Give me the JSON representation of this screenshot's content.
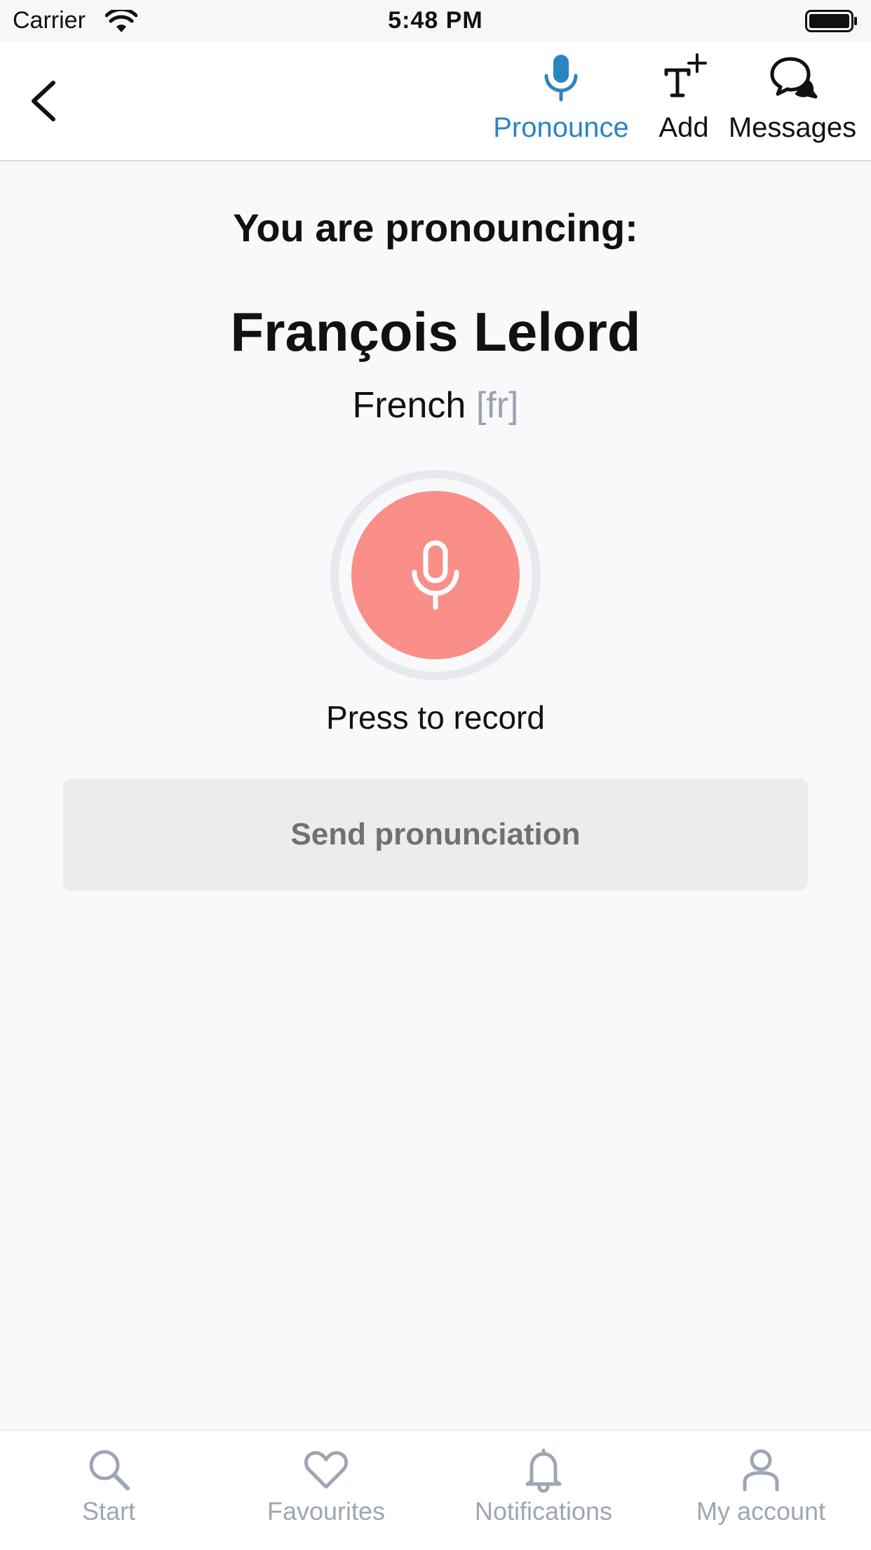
{
  "status_bar": {
    "carrier": "Carrier",
    "time": "5:48 PM"
  },
  "nav": {
    "tabs": [
      {
        "label": "Pronounce",
        "icon": "microphone-icon",
        "active": true
      },
      {
        "label": "Add",
        "icon": "add-text-icon",
        "active": false
      },
      {
        "label": "Messages",
        "icon": "chat-bubbles-icon",
        "active": false
      }
    ]
  },
  "main": {
    "heading": "You are pronouncing:",
    "name": "François Lelord",
    "language": "French",
    "language_code": "[fr]",
    "record_hint": "Press to record",
    "send_label": "Send pronunciation"
  },
  "tabbar": {
    "items": [
      {
        "label": "Start",
        "icon": "search-icon"
      },
      {
        "label": "Favourites",
        "icon": "heart-icon"
      },
      {
        "label": "Notifications",
        "icon": "bell-icon"
      },
      {
        "label": "My account",
        "icon": "user-icon"
      }
    ]
  },
  "colors": {
    "accent": "#2a85c2",
    "record": "#f98f88",
    "tab_inactive": "#9ea6b3"
  }
}
